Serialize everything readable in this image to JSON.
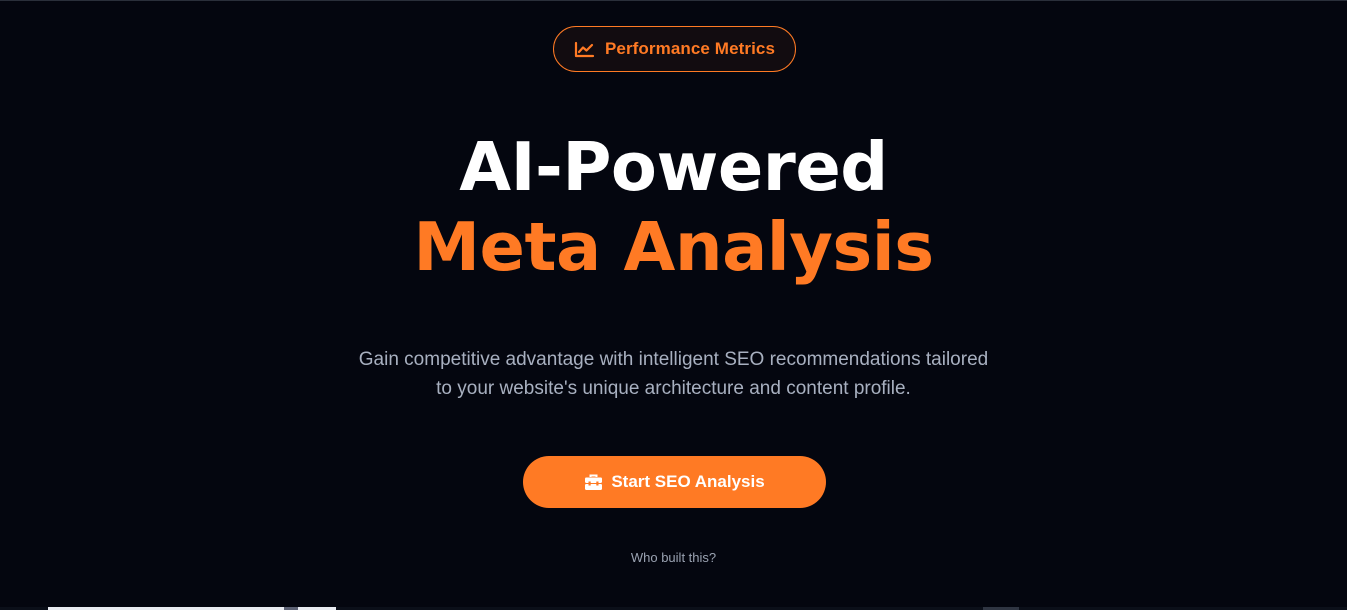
{
  "badge": {
    "icon": "chart-line-icon",
    "label": "Performance Metrics"
  },
  "hero": {
    "title_line_1": "AI-Powered",
    "title_line_2": "Meta Analysis",
    "subtitle_line_1": "Gain competitive advantage with intelligent SEO recommendations tailored",
    "subtitle_line_2": "to your website's unique architecture and content profile."
  },
  "cta": {
    "icon": "toolbox-icon",
    "label": "Start SEO Analysis"
  },
  "footer": {
    "link_label": "Who built this?"
  },
  "colors": {
    "background": "#04060f",
    "accent": "#ff7a24",
    "heading": "#ffffff",
    "muted_text": "#a8b0c0"
  }
}
